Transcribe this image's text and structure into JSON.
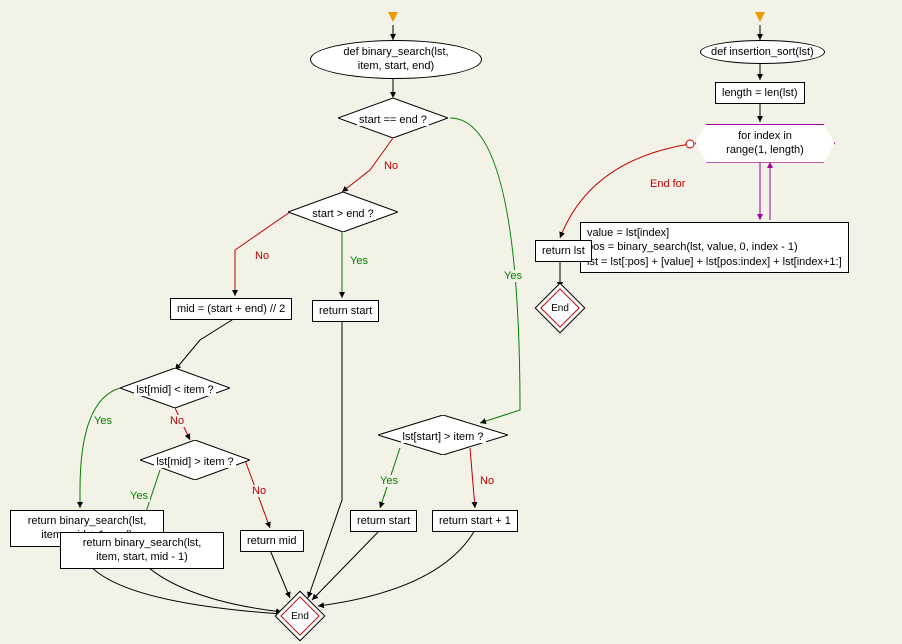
{
  "left": {
    "func_def": "def binary_search(lst,\nitem, start, end)",
    "cond1": "start == end ?",
    "cond2": "start > end ?",
    "cond3": "lst[start] > item ?",
    "ret_start_plus1": "return start + 1",
    "ret_start_a": "return start",
    "ret_start_b": "return start",
    "mid_assign": "mid = (start + end) // 2",
    "cond4": "lst[mid] < item ?",
    "ret_recurse_right": "return binary_search(lst,\nitem, mid + 1, end)",
    "cond5": "lst[mid] > item ?",
    "ret_recurse_left": "return binary_search(lst,\nitem, start, mid - 1)",
    "ret_mid": "return mid",
    "end": "End"
  },
  "right": {
    "func_def": "def insertion_sort(lst)",
    "len_assign": "length = len(lst)",
    "for_loop": "for index in\nrange(1, length)",
    "loop_body": "value = lst[index]\npos = binary_search(lst, value, 0, index - 1)\nlst = lst[:pos] + [value] + lst[pos:index] + lst[index+1:]",
    "ret_lst": "return lst",
    "end": "End"
  },
  "labels": {
    "yes": "Yes",
    "no": "No",
    "end_for": "End for"
  }
}
